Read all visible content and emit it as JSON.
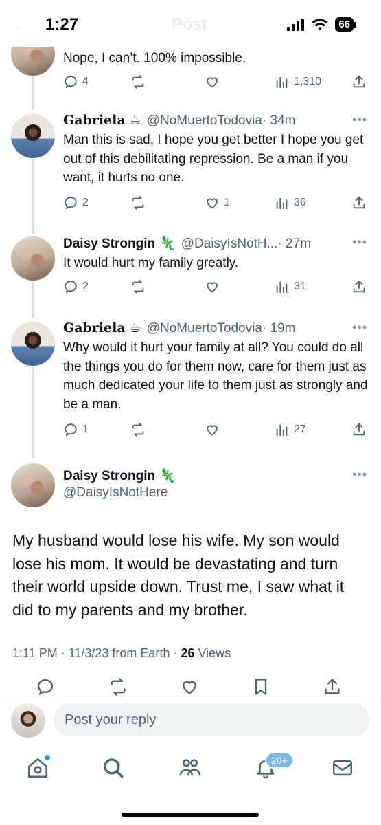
{
  "status_bar": {
    "time": "1:27",
    "battery": "66",
    "header_ghost": "Post"
  },
  "tweets": [
    {
      "text": "Nope, I can’t. 100% impossible.",
      "replies": "4",
      "retweets": "",
      "likes": "",
      "views": "1,310"
    },
    {
      "name": "Gabriela",
      "emoji": "☕",
      "handle": "@NoMuertoTodovia",
      "time": "· 34m",
      "text": "Man this is sad, I hope you get better I hope you get out of this debilitating repression. Be a man if you want, it hurts no one.",
      "replies": "2",
      "retweets": "",
      "likes": "1",
      "views": "36"
    },
    {
      "name": "Daisy Strongin",
      "emoji": "🦎",
      "handle": "@DaisyIsNotH...",
      "time": "· 27m",
      "text": "It would hurt my family greatly.",
      "replies": "2",
      "retweets": "",
      "likes": "",
      "views": "31"
    },
    {
      "name": "Gabriela",
      "emoji": "☕",
      "handle": "@NoMuertoTodovia",
      "time": "· 19m",
      "text": "Why would it hurt your family at all? You could do all the things you do for them now, care for them just as much dedicated your life to them just as strongly and be a man.",
      "replies": "1",
      "retweets": "",
      "likes": "",
      "views": "27"
    }
  ],
  "main_tweet": {
    "name": "Daisy Strongin",
    "emoji": "🦎",
    "handle": "@DaisyIsNotHere",
    "text": "My husband would lose his wife. My son would lose his mom. It would be devastating and turn their world upside down. Trust me, I saw what it did to my parents and my brother.",
    "meta_prefix": "1:11 PM · 11/3/23 from Earth · ",
    "views_count": "26",
    "views_label": " Views"
  },
  "reply_bar": {
    "placeholder": "Post your reply"
  },
  "tabbar": {
    "notifications_badge": "20+"
  },
  "colors": {
    "accent": "#1d9bf0",
    "muted": "#536471",
    "text": "#0f1419"
  }
}
